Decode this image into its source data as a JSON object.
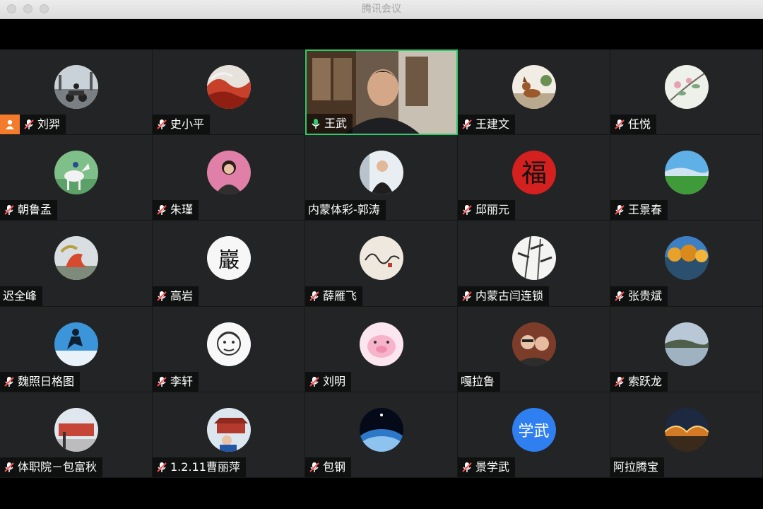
{
  "window": {
    "title": "腾讯会议"
  },
  "participants": [
    {
      "name": "刘羿",
      "mic": "muted",
      "host": true,
      "avatar": "motorcycle-photo"
    },
    {
      "name": "史小平",
      "mic": "muted",
      "avatar": "red-landscape-photo"
    },
    {
      "name": "王武",
      "mic": "speaking",
      "active": true,
      "avatar": "camera-video"
    },
    {
      "name": "王建文",
      "mic": "muted",
      "avatar": "dog-photo"
    },
    {
      "name": "任悦",
      "mic": "muted",
      "avatar": "flower-painting"
    },
    {
      "name": "朝鲁孟",
      "mic": "muted",
      "avatar": "horse-photo"
    },
    {
      "name": "朱瑾",
      "mic": "muted",
      "avatar": "portrait-photo"
    },
    {
      "name": "内蒙体彩-郭涛",
      "mic": "none",
      "avatar": "man-portrait"
    },
    {
      "name": "邱丽元",
      "mic": "muted",
      "avatar": "fu-character"
    },
    {
      "name": "王景春",
      "mic": "muted",
      "avatar": "grassland-photo"
    },
    {
      "name": "迟全峰",
      "mic": "none",
      "avatar": "sculpture-photo"
    },
    {
      "name": "高岩",
      "mic": "muted",
      "avatar": "calligraphy-seal"
    },
    {
      "name": "薛雁飞",
      "mic": "muted",
      "avatar": "signature-art"
    },
    {
      "name": "内蒙古闫连锁",
      "mic": "muted",
      "avatar": "bamboo-painting"
    },
    {
      "name": "张贵斌",
      "mic": "muted",
      "avatar": "autumn-trees-photo"
    },
    {
      "name": "魏照日格图",
      "mic": "muted",
      "avatar": "jump-silhouette"
    },
    {
      "name": "李轩",
      "mic": "muted",
      "avatar": "face-sketch"
    },
    {
      "name": "刘明",
      "mic": "muted",
      "avatar": "pig-cartoon"
    },
    {
      "name": "嘎拉鲁",
      "mic": "none",
      "avatar": "family-selfie"
    },
    {
      "name": "索跃龙",
      "mic": "muted",
      "avatar": "lake-photo"
    },
    {
      "name": "体职院－包富秋",
      "mic": "muted",
      "avatar": "building-photo"
    },
    {
      "name": "1.2.11曹丽萍",
      "mic": "muted",
      "avatar": "tiananmen-photo"
    },
    {
      "name": "包钢",
      "mic": "muted",
      "avatar": "earth-space-photo"
    },
    {
      "name": "景学武",
      "mic": "muted",
      "avatar": "text-avatar",
      "avatar_text": "学武",
      "avatar_color": "#2f7ff0"
    },
    {
      "name": "阿拉腾宝",
      "mic": "none",
      "avatar": "bridge-night-photo"
    }
  ],
  "colors": {
    "tile_bg": "#232425",
    "active_border": "#2fca6a",
    "host_badge": "#f47b2b",
    "speaking_mic": "#2fca6a",
    "muted_mic": "#ff4d4f"
  }
}
